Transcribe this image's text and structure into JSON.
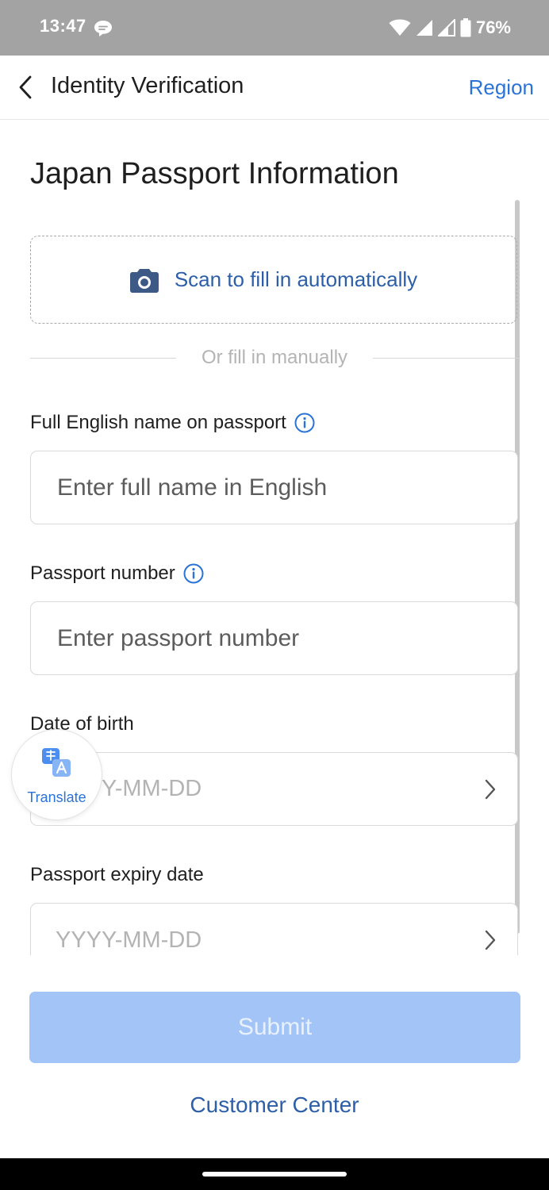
{
  "status_bar": {
    "time": "13:47",
    "battery_percent": "76%",
    "icons": [
      "chat-bubble-icon",
      "wifi-icon",
      "signal-icon",
      "signal-icon",
      "battery-icon"
    ]
  },
  "header": {
    "title": "Identity Verification",
    "region_link": "Region",
    "back_icon": "chevron-left-icon"
  },
  "page": {
    "title": "Japan Passport Information"
  },
  "scan": {
    "label": "Scan to fill in automatically",
    "icon": "camera-icon"
  },
  "divider": {
    "text": "Or fill in manually"
  },
  "fields": {
    "full_name": {
      "label": "Full English name on passport",
      "placeholder": "Enter full name in English",
      "value": ""
    },
    "passport_number": {
      "label": "Passport number",
      "placeholder": "Enter passport number",
      "value": ""
    },
    "date_of_birth": {
      "label": "Date of birth",
      "placeholder": "YYYY-MM-DD"
    },
    "expiry_date": {
      "label": "Passport expiry date",
      "placeholder": "YYYY-MM-DD"
    }
  },
  "translate": {
    "label": "Translate",
    "icon": "translate-icon"
  },
  "actions": {
    "submit_label": "Submit",
    "customer_center_label": "Customer Center"
  },
  "colors": {
    "accent": "#2b73d6",
    "link_dark": "#2d5fa8",
    "submit_disabled": "#a3c4f7",
    "status_bar": "#a3a3a3"
  }
}
